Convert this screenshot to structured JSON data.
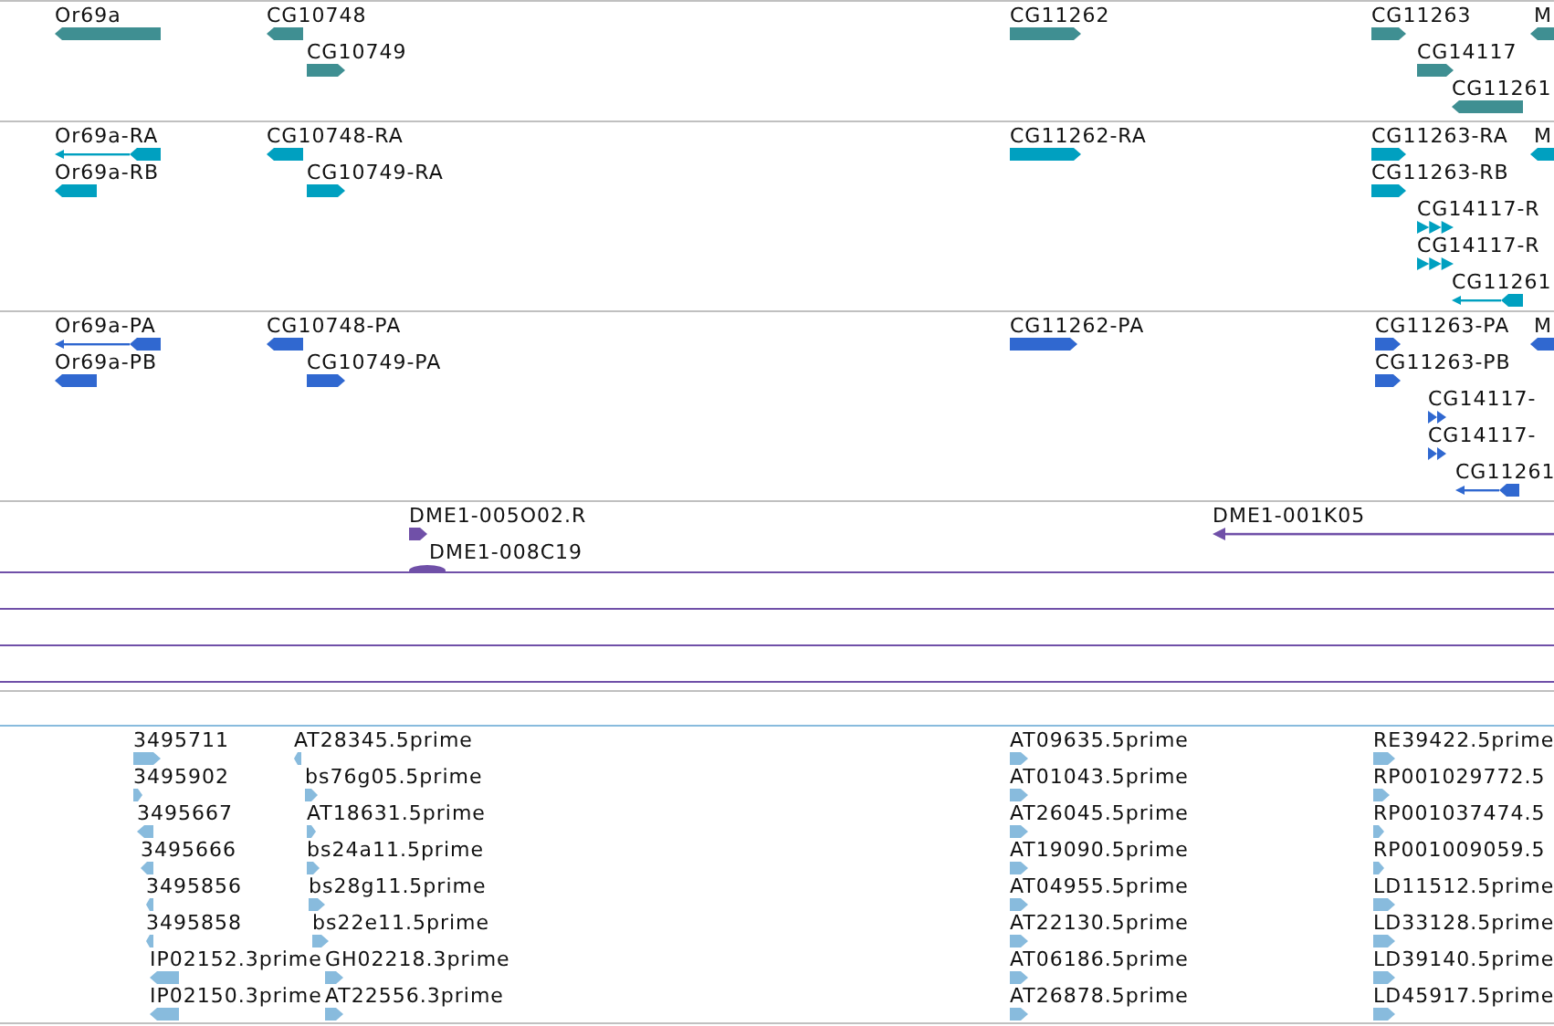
{
  "tracks": [
    {
      "color": "#3f8f92",
      "features": [
        {
          "label": "Or69a",
          "reverse": true,
          "kind": "block"
        },
        {
          "label": "CG10748",
          "reverse": true,
          "kind": "block"
        },
        {
          "label": "CG10749",
          "reverse": false,
          "kind": "block"
        },
        {
          "label": "CG11262",
          "reverse": false,
          "kind": "block"
        },
        {
          "label": "CG11263",
          "reverse": false,
          "kind": "block"
        },
        {
          "label": "M",
          "reverse": true,
          "kind": "block"
        },
        {
          "label": "CG14117",
          "reverse": false,
          "kind": "block"
        },
        {
          "label": "CG11261",
          "reverse": true,
          "kind": "block"
        }
      ]
    },
    {
      "color": "#00a0c0",
      "features": [
        {
          "label": "Or69a-RA",
          "reverse": true,
          "kind": "spliced"
        },
        {
          "label": "Or69a-RB",
          "reverse": true,
          "kind": "block"
        },
        {
          "label": "CG10748-RA",
          "reverse": true,
          "kind": "block"
        },
        {
          "label": "CG10749-RA",
          "reverse": false,
          "kind": "block"
        },
        {
          "label": "CG11262-RA",
          "reverse": false,
          "kind": "block"
        },
        {
          "label": "CG11263-RA",
          "reverse": false,
          "kind": "block"
        },
        {
          "label": "M",
          "reverse": true,
          "kind": "block"
        },
        {
          "label": "CG11263-RB",
          "reverse": false,
          "kind": "block"
        },
        {
          "label": "CG14117-R",
          "reverse": false,
          "kind": "chevrons"
        },
        {
          "label": "CG14117-R",
          "reverse": false,
          "kind": "chevrons"
        },
        {
          "label": "CG11261",
          "reverse": true,
          "kind": "spliced"
        }
      ]
    },
    {
      "color": "#3068d0",
      "features": [
        {
          "label": "Or69a-PA",
          "reverse": true,
          "kind": "spliced"
        },
        {
          "label": "Or69a-PB",
          "reverse": true,
          "kind": "block"
        },
        {
          "label": "CG10748-PA",
          "reverse": true,
          "kind": "block"
        },
        {
          "label": "CG10749-PA",
          "reverse": false,
          "kind": "block"
        },
        {
          "label": "CG11262-PA",
          "reverse": false,
          "kind": "block"
        },
        {
          "label": "CG11263-PA",
          "reverse": false,
          "kind": "block"
        },
        {
          "label": "M",
          "reverse": true,
          "kind": "block"
        },
        {
          "label": "CG11263-PB",
          "reverse": false,
          "kind": "block"
        },
        {
          "label": "CG14117-",
          "reverse": false,
          "kind": "chevrons"
        },
        {
          "label": "CG14117-",
          "reverse": false,
          "kind": "chevrons"
        },
        {
          "label": "CG11261",
          "reverse": true,
          "kind": "spliced"
        }
      ]
    },
    {
      "color": "#7050a8",
      "features": [
        {
          "label": "DME1-005O02.R",
          "reverse": false,
          "kind": "block"
        },
        {
          "label": "DME1-008C19",
          "kind": "oval"
        },
        {
          "label": "DME1-001K05",
          "reverse": true,
          "kind": "line"
        }
      ]
    },
    {
      "color": "#88bbdd",
      "features": [
        {
          "label": "3495711",
          "reverse": false,
          "kind": "block"
        },
        {
          "label": "3495902",
          "reverse": false,
          "kind": "block"
        },
        {
          "label": "3495667",
          "reverse": true,
          "kind": "block"
        },
        {
          "label": "3495666",
          "reverse": true,
          "kind": "block"
        },
        {
          "label": "3495856",
          "reverse": true,
          "kind": "block"
        },
        {
          "label": "3495858",
          "reverse": true,
          "kind": "block"
        },
        {
          "label": "IP02152.3prime",
          "reverse": true,
          "kind": "block"
        },
        {
          "label": "IP02150.3prime",
          "reverse": true,
          "kind": "block"
        },
        {
          "label": "AT28345.5prime",
          "reverse": true,
          "kind": "block"
        },
        {
          "label": "bs76g05.5prime",
          "reverse": false,
          "kind": "block"
        },
        {
          "label": "AT18631.5prime",
          "reverse": false,
          "kind": "block"
        },
        {
          "label": "bs24a11.5prime",
          "reverse": false,
          "kind": "block"
        },
        {
          "label": "bs28g11.5prime",
          "reverse": false,
          "kind": "block"
        },
        {
          "label": "bs22e11.5prime",
          "reverse": false,
          "kind": "block"
        },
        {
          "label": "GH02218.3prime",
          "reverse": false,
          "kind": "block"
        },
        {
          "label": "AT22556.3prime",
          "reverse": false,
          "kind": "block"
        },
        {
          "label": "AT09635.5prime",
          "reverse": false,
          "kind": "block"
        },
        {
          "label": "AT01043.5prime",
          "reverse": false,
          "kind": "block"
        },
        {
          "label": "AT26045.5prime",
          "reverse": false,
          "kind": "block"
        },
        {
          "label": "AT19090.5prime",
          "reverse": false,
          "kind": "block"
        },
        {
          "label": "AT04955.5prime",
          "reverse": false,
          "kind": "block"
        },
        {
          "label": "AT22130.5prime",
          "reverse": false,
          "kind": "block"
        },
        {
          "label": "AT06186.5prime",
          "reverse": false,
          "kind": "block"
        },
        {
          "label": "AT26878.5prime",
          "reverse": false,
          "kind": "block"
        },
        {
          "label": "RE39422.5prime",
          "reverse": false,
          "kind": "block"
        },
        {
          "label": "RP001029772.5",
          "reverse": false,
          "kind": "block"
        },
        {
          "label": "RP001037474.5",
          "reverse": false,
          "kind": "block"
        },
        {
          "label": "RP001009059.5",
          "reverse": false,
          "kind": "block"
        },
        {
          "label": "LD11512.5prime",
          "reverse": false,
          "kind": "block"
        },
        {
          "label": "LD33128.5prime",
          "reverse": false,
          "kind": "block"
        },
        {
          "label": "LD39140.5prime",
          "reverse": false,
          "kind": "block"
        },
        {
          "label": "LD45917.5prime",
          "reverse": false,
          "kind": "block"
        }
      ]
    }
  ]
}
